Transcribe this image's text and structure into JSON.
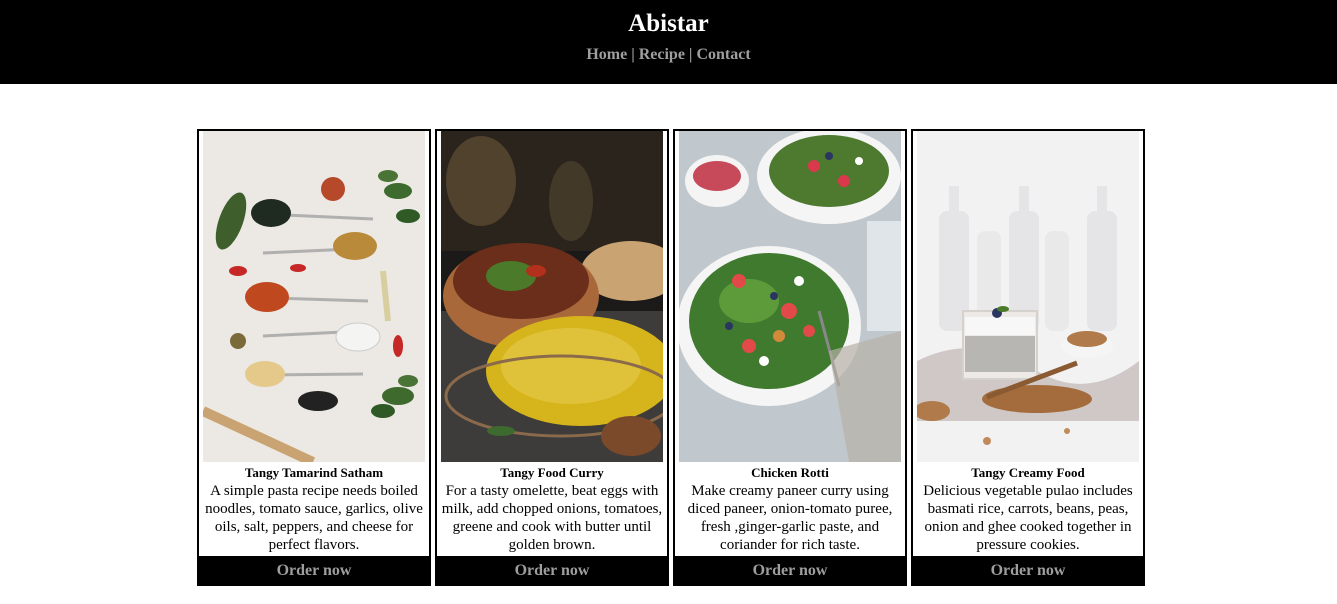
{
  "header": {
    "title": "Abistar",
    "nav": [
      {
        "label": "Home"
      },
      {
        "label": "Recipe"
      },
      {
        "label": "Contact"
      }
    ],
    "separator": "|"
  },
  "cards": [
    {
      "title": "Tangy Tamarind Satham",
      "description": "A simple pasta recipe needs boiled noodles, tomato sauce, garlics, olive oils, salt, peppers, and cheese for perfect flavors.",
      "button": "Order now",
      "image": "spices-on-spoons-photo"
    },
    {
      "title": "Tangy Food Curry",
      "description": "For a tasty omelette, beat eggs with milk, add chopped onions, tomatoes, greene and cook with butter until golden brown.",
      "button": "Order now",
      "image": "curry-and-rice-photo"
    },
    {
      "title": "Chicken Rotti",
      "description": "Make creamy paneer curry using diced paneer, onion-tomato puree, fresh ,ginger-garlic paste, and coriander for rich taste.",
      "button": "Order now",
      "image": "salad-bowls-photo"
    },
    {
      "title": "Tangy Creamy Food",
      "description": "Delicious vegetable pulao includes basmati rice, carrots, beans, peas, onion and ghee cooked together in pressure cookies.",
      "button": "Order now",
      "image": "chia-pudding-photo"
    }
  ],
  "colors": {
    "header_bg": "#000000",
    "title": "#ffffff",
    "nav": "#9e9e9e",
    "button_bg": "#000000",
    "button_text": "#9e9e9e"
  }
}
